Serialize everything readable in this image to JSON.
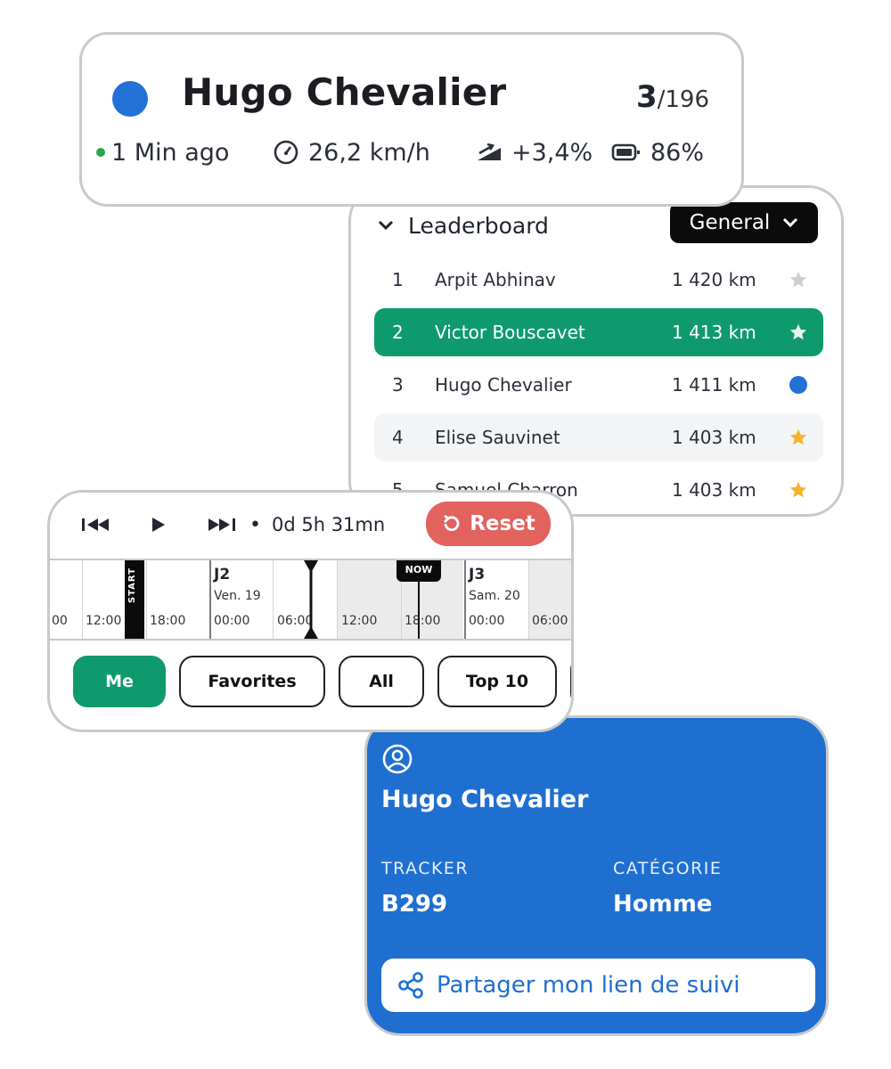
{
  "colors": {
    "rider_dot": "#2371d6",
    "online_green": "#28a44a",
    "highlight_green": "#0f9a6e",
    "reset_red": "#e2625e",
    "profile_blue": "#1f6fd1",
    "star_gold": "#f3b32a",
    "star_grey": "#cfcfcf"
  },
  "status_card": {
    "name": "Hugo Chevalier",
    "rank": "3",
    "rank_total": "/196",
    "last_seen": "1 Min ago",
    "speed": "26,2 km/h",
    "slope": "+3,4%",
    "battery": "86%",
    "icons": [
      "speedometer-icon",
      "slope-icon",
      "battery-icon"
    ]
  },
  "leaderboard": {
    "title": "Leaderboard",
    "filter_label": "General",
    "rows": [
      {
        "pos": "1",
        "name": "Arpit Abhinav",
        "distance": "1 420 km",
        "marker": "star-grey"
      },
      {
        "pos": "2",
        "name": "Victor Bouscavet",
        "distance": "1 413 km",
        "marker": "star-white"
      },
      {
        "pos": "3",
        "name": "Hugo Chevalier",
        "distance": "1 411 km",
        "marker": "dot-blue"
      },
      {
        "pos": "4",
        "name": "Elise Sauvinet",
        "distance": "1 403 km",
        "marker": "star-gold"
      },
      {
        "pos": "5",
        "name": "Samuel Charron",
        "distance": "1 403 km",
        "marker": "star-gold"
      }
    ]
  },
  "timeline": {
    "elapsed": "0d 5h 31mn",
    "reset_label": "Reset",
    "start_label": "START",
    "now_label": "NOW",
    "days": [
      {
        "label": "J2",
        "date": "Ven. 19"
      },
      {
        "label": "J3",
        "date": "Sam. 20"
      }
    ],
    "ticks": [
      "00",
      "12:00",
      "18:00",
      "00:00",
      "06:00",
      "12:00",
      "18:00",
      "00:00",
      "06:00"
    ]
  },
  "filters": [
    "Me",
    "Favorites",
    "All",
    "Top 10"
  ],
  "profile": {
    "name": "Hugo Chevalier",
    "tracker_label": "TRACKER",
    "tracker_value": "B299",
    "category_label": "CATÉGORIE",
    "category_value": "Homme",
    "share_label": "Partager mon lien de suivi"
  }
}
